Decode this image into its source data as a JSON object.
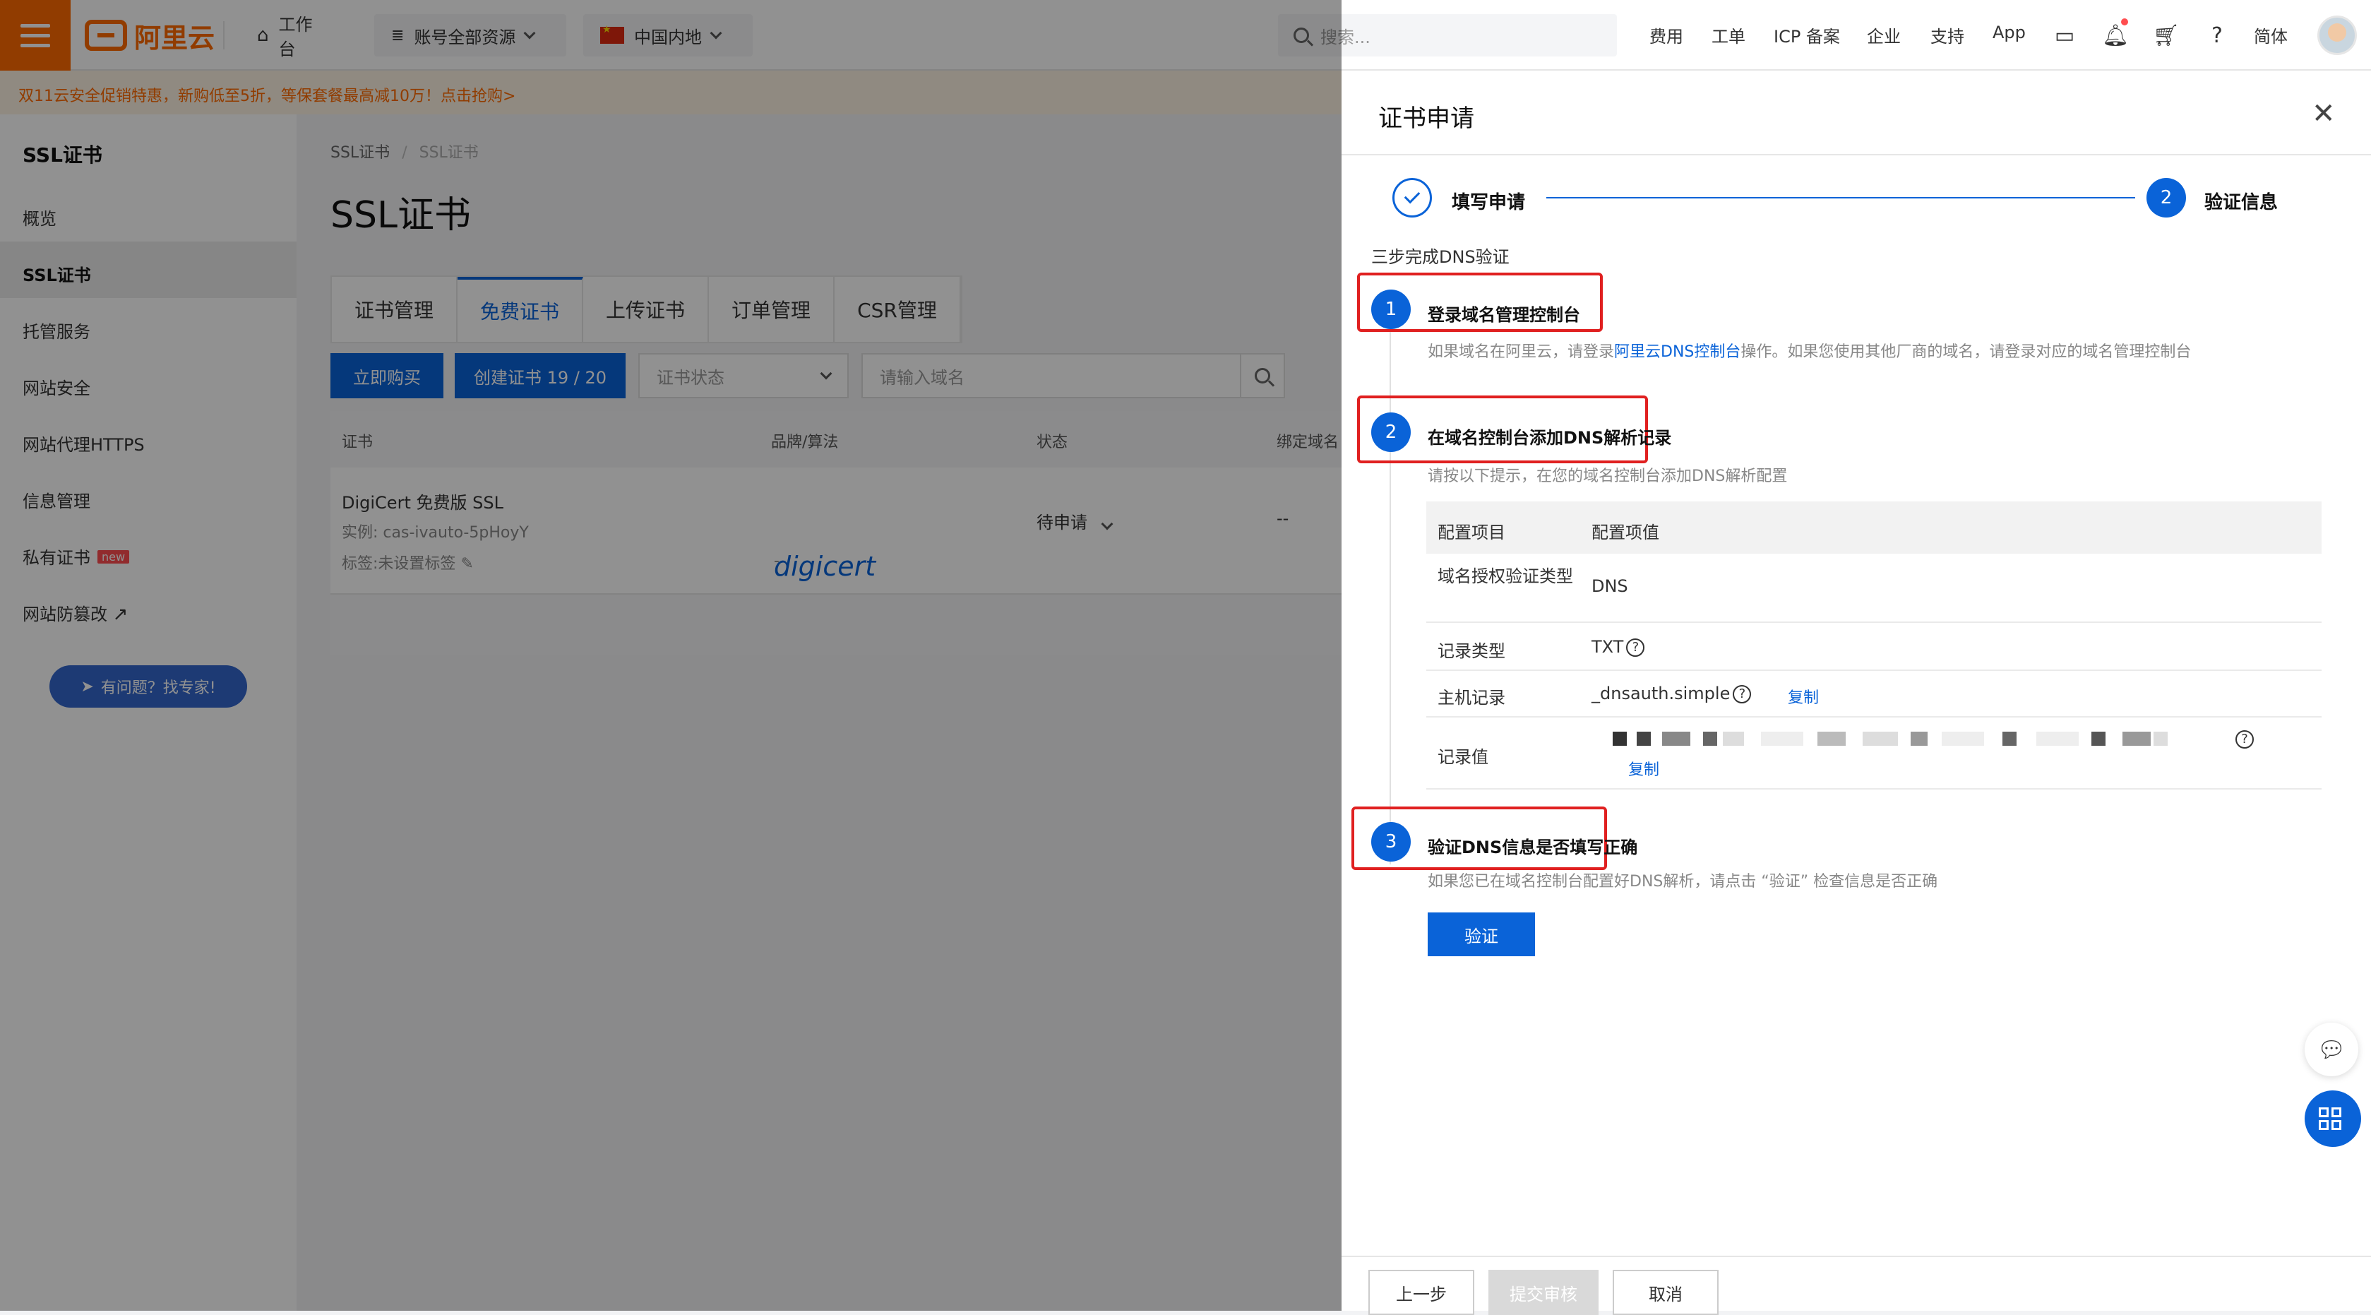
{
  "header": {
    "logo_text": "阿里云",
    "workbench": "工作台",
    "account_resources": "账号全部资源",
    "region": "中国内地",
    "search_placeholder": "搜索...",
    "links": [
      "费用",
      "工单",
      "ICP 备案",
      "企业",
      "支持",
      "App"
    ],
    "lang": "简体"
  },
  "promo": "双11云安全促销特惠，新购低至5折，等保套餐最高减10万！点击抢购>",
  "sidebar": {
    "title": "SSL证书",
    "items": [
      {
        "label": "概览"
      },
      {
        "label": "SSL证书"
      },
      {
        "label": "托管服务"
      },
      {
        "label": "网站安全"
      },
      {
        "label": "网站代理HTTPS"
      },
      {
        "label": "信息管理"
      },
      {
        "label": "私有证书",
        "badge": "new"
      },
      {
        "label": "网站防篡改"
      }
    ],
    "help_button": "有问题？找专家!"
  },
  "main": {
    "breadcrumb": [
      "SSL证书",
      "SSL证书"
    ],
    "breadcrumb_sep": "/",
    "title": "SSL证书",
    "tabs": [
      "证书管理",
      "免费证书",
      "上传证书",
      "订单管理",
      "CSR管理"
    ],
    "buy_button": "立即购买",
    "create_button": "创建证书 19 / 20",
    "status_placeholder": "证书状态",
    "domain_placeholder": "请输入域名",
    "table": {
      "headers": [
        "证书",
        "品牌/算法",
        "状态",
        "绑定域名"
      ],
      "rows": [
        {
          "name": "DigiCert 免费版 SSL",
          "instance": "实例: cas-ivauto-5pHoyY",
          "tag": "标签:未设置标签",
          "brand": "digicert",
          "brand_sub": "-",
          "status": "待申请",
          "domain": "--"
        }
      ]
    }
  },
  "drawer": {
    "title": "证书申请",
    "steps": [
      {
        "label": "填写申请",
        "num": "1"
      },
      {
        "label": "验证信息",
        "num": "2"
      }
    ],
    "intro": "三步完成DNS验证",
    "step1": {
      "num": "1",
      "title": "登录域名管理控制台",
      "desc_pre": "如果域名在阿里云，请登录",
      "desc_link": "阿里云DNS控制台",
      "desc_post": "操作。如果您使用其他厂商的域名，请登录对应的域名管理控制台"
    },
    "step2": {
      "num": "2",
      "title": "在域名控制台添加DNS解析记录",
      "desc": "请按以下提示，在您的域名控制台添加DNS解析配置",
      "table_headers": [
        "配置项目",
        "配置项值"
      ],
      "rows": [
        {
          "key": "域名授权验证类型",
          "value": "DNS"
        },
        {
          "key": "记录类型",
          "value": "TXT"
        },
        {
          "key": "主机记录",
          "value": "_dnsauth.simple",
          "copy": "复制"
        },
        {
          "key": "记录值",
          "value": "",
          "copy": "复制"
        }
      ]
    },
    "step3": {
      "num": "3",
      "title": "验证DNS信息是否填写正确",
      "desc": "如果您已在域名控制台配置好DNS解析，请点击 “验证” 检查信息是否正确",
      "button": "验证"
    },
    "footer": {
      "prev": "上一步",
      "submit": "提交审核",
      "cancel": "取消"
    }
  },
  "colors": {
    "brand": "#ff6a00",
    "primary": "#0a63d8",
    "highlight_box": "#e02020"
  }
}
